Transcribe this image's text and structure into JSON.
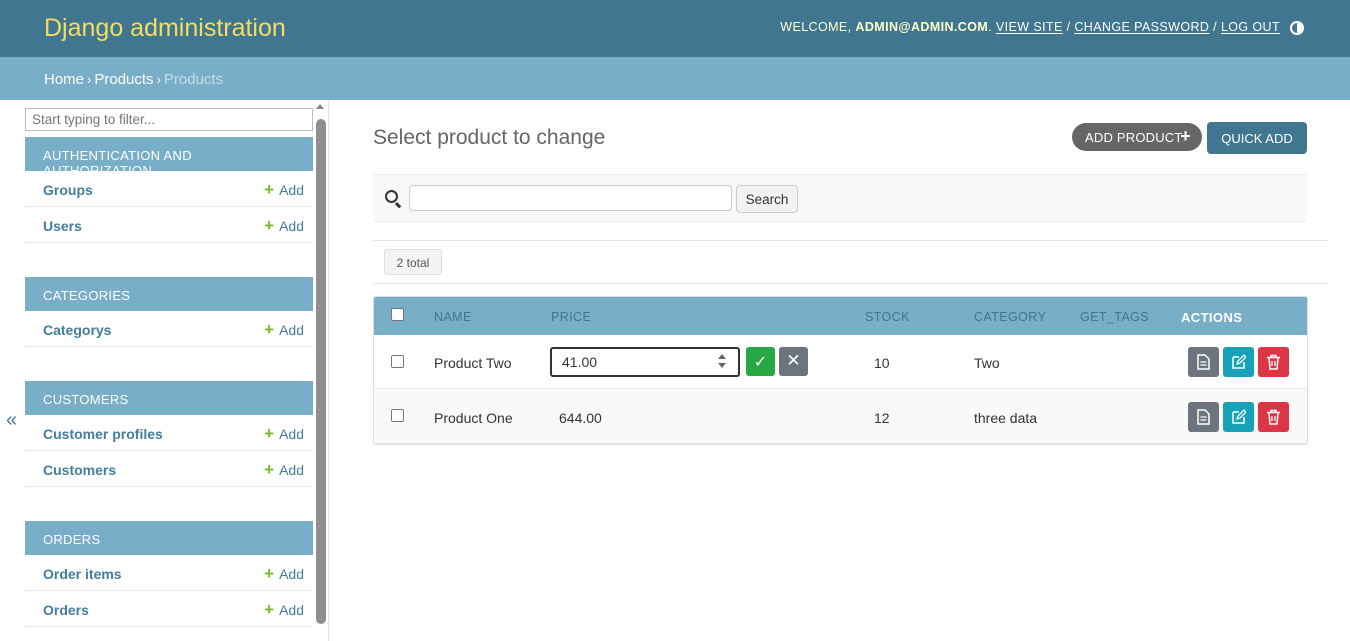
{
  "header": {
    "site_title": "Django administration",
    "welcome": "Welcome,",
    "username": "admin@admin.com",
    "view_site": "View site",
    "change_password": "Change password",
    "log_out": "Log out"
  },
  "breadcrumbs": {
    "home": "Home",
    "app": "Products",
    "current": "Products"
  },
  "sidebar": {
    "filter_placeholder": "Start typing to filter...",
    "collapse_glyph": "«",
    "modules": [
      {
        "caption": "Authentication and Authorization",
        "items": [
          {
            "label": "Groups",
            "add": "Add"
          },
          {
            "label": "Users",
            "add": "Add"
          }
        ]
      },
      {
        "caption": "Categories",
        "items": [
          {
            "label": "Categorys",
            "add": "Add"
          }
        ]
      },
      {
        "caption": "Customers",
        "items": [
          {
            "label": "Customer profiles",
            "add": "Add"
          },
          {
            "label": "Customers",
            "add": "Add"
          }
        ]
      },
      {
        "caption": "Orders",
        "items": [
          {
            "label": "Order items",
            "add": "Add"
          },
          {
            "label": "Orders",
            "add": "Add"
          }
        ]
      }
    ]
  },
  "content": {
    "title": "Select product to change",
    "add_product": "Add Product",
    "quick_add": "QUICK ADD",
    "search_button": "Search",
    "total": "2 total",
    "columns": [
      "Name",
      "Price",
      "Stock",
      "Category",
      "get_tags",
      "Actions"
    ],
    "rows": [
      {
        "name": "Product Two",
        "price": "41.00",
        "stock": "10",
        "category": "Two",
        "tags": ""
      },
      {
        "name": "Product One",
        "price": "644.00",
        "stock": "12",
        "category": "three data",
        "tags": ""
      }
    ],
    "save_glyph": "✓",
    "cancel_glyph": "✕"
  },
  "colors": {
    "header": "#417690",
    "breadcrumb": "#79aec8",
    "site_title": "#f5dd5d",
    "link": "#447e9b",
    "add_plus": "#70bf2b",
    "save": "#28a745",
    "view": "#6c757d",
    "edit": "#17a2b8",
    "delete": "#dc3545"
  },
  "icons": {
    "theme": "theme-toggle-icon",
    "search": "search-icon",
    "view": "document-icon",
    "edit": "edit-icon",
    "delete": "trash-icon"
  }
}
